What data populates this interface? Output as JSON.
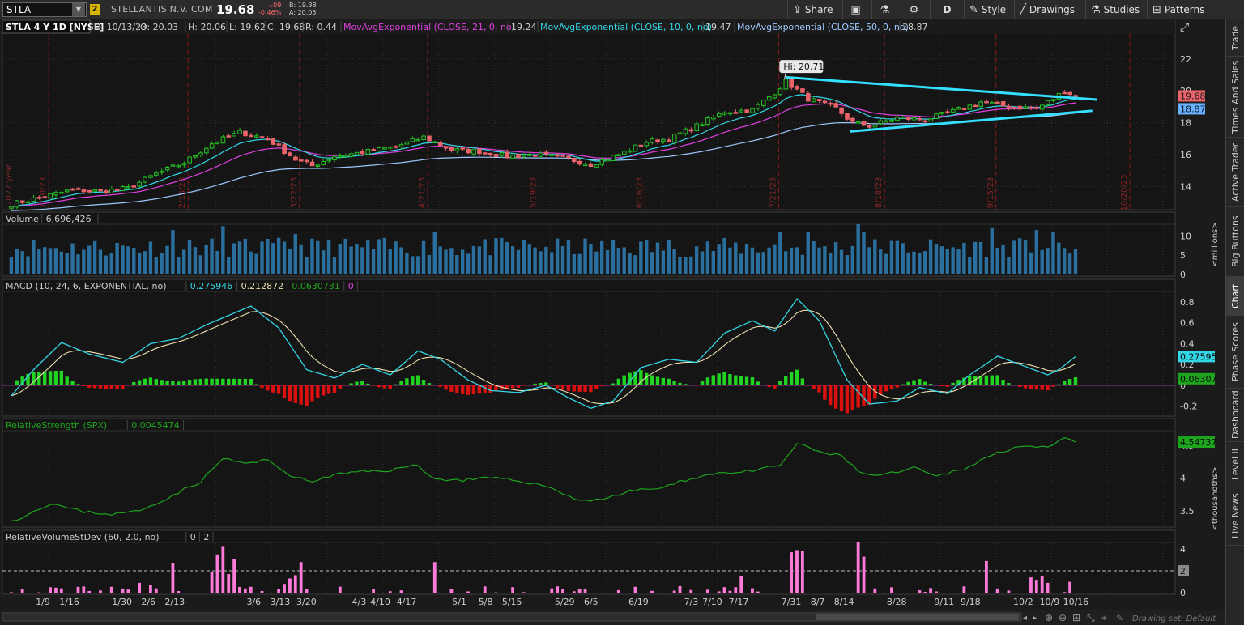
{
  "toolbar": {
    "symbol": "STLA",
    "link_group": "2",
    "company": "STELLANTIS N.V. COM",
    "last": "19.68",
    "change": "-.09",
    "change_pct": "-0.46%",
    "bid": "B: 19.38",
    "ask": "A: 20.05",
    "share": "Share",
    "aggregation": "D",
    "style": "Style",
    "drawings": "Drawings",
    "studies": "Studies",
    "patterns": "Patterns"
  },
  "side_tabs": [
    "Trade",
    "Times And Sales",
    "Active Trader",
    "Big Buttons",
    "Chart",
    "Phase Scores",
    "Dashboard",
    "Level II",
    "Live News"
  ],
  "colors": {
    "up": "#22c322",
    "down": "#e8646a",
    "ema21": "#e040e0",
    "ema10": "#33d6e6",
    "ema50": "#9ec8ff",
    "trend": "#33e0ff",
    "volume": "#2a6f9e",
    "macd_pos": "#22d422",
    "macd_neg": "#dd1010",
    "rs": "#1ea51e",
    "relvol": "#ff7ad9"
  },
  "chart_data": [
    {
      "type": "candlestick",
      "panel": "price",
      "title": "STLA 4 Y 1D [NYSE]",
      "ohlc_header": {
        "d": "D: 10/13/23",
        "o": "O: 20.03",
        "h": "H: 20.06",
        "l": "L: 19.62",
        "c": "C: 19.68",
        "r": "R: 0.44"
      },
      "studies": [
        {
          "name": "MovAvgExponential (CLOSE, 21, 0, no)",
          "value": "19.24",
          "color": "#e040e0"
        },
        {
          "name": "MovAvgExponential (CLOSE, 10, 0, no)",
          "value": "19.47",
          "color": "#33d6e6"
        },
        {
          "name": "MovAvgExponential (CLOSE, 50, 0, no)",
          "value": "18.87",
          "color": "#9ec8ff"
        }
      ],
      "yticks": [
        "22",
        "20",
        "18",
        "16",
        "14"
      ],
      "ylim": [
        12.6,
        22.8
      ],
      "price_labels": [
        {
          "text": "19.68",
          "value": 19.68
        },
        {
          "text": "18.87",
          "value": 18.87
        }
      ],
      "hi_label": "Hi: 20.71",
      "hi_value": 20.71,
      "hi_index": 139,
      "period_markers": [
        "2022 year",
        "1/10/23",
        "2/15/23",
        "3/22/23",
        "4/21/23",
        "5/19/23",
        "6/16/23",
        "7/21/23",
        "8/18/23",
        "9/15/23",
        "10/20/23"
      ],
      "marker_dates": [
        "1/10/23",
        "2/15/23",
        "3/22/23",
        "4/21/23",
        "5/19/23",
        "6/16/23",
        "7/21/23",
        "8/18/23",
        "9/15/23",
        "10/20/23"
      ],
      "anchors": [
        {
          "i": 0,
          "c": 12.9
        },
        {
          "i": 5,
          "c": 13.3
        },
        {
          "i": 11,
          "c": 13.8
        },
        {
          "i": 16,
          "c": 13.7
        },
        {
          "i": 21,
          "c": 13.9
        },
        {
          "i": 26,
          "c": 14.8
        },
        {
          "i": 31,
          "c": 15.5
        },
        {
          "i": 36,
          "c": 16.7
        },
        {
          "i": 41,
          "c": 17.4
        },
        {
          "i": 46,
          "c": 17.0
        },
        {
          "i": 51,
          "c": 15.7
        },
        {
          "i": 54,
          "c": 15.3
        },
        {
          "i": 58,
          "c": 15.9
        },
        {
          "i": 64,
          "c": 16.2
        },
        {
          "i": 69,
          "c": 16.5
        },
        {
          "i": 74,
          "c": 17.1
        },
        {
          "i": 79,
          "c": 16.3
        },
        {
          "i": 84,
          "c": 16.2
        },
        {
          "i": 89,
          "c": 15.9
        },
        {
          "i": 94,
          "c": 16.0
        },
        {
          "i": 99,
          "c": 15.8
        },
        {
          "i": 104,
          "c": 15.4
        },
        {
          "i": 109,
          "c": 16.0
        },
        {
          "i": 114,
          "c": 16.8
        },
        {
          "i": 118,
          "c": 17.0
        },
        {
          "i": 123,
          "c": 17.8
        },
        {
          "i": 128,
          "c": 18.7
        },
        {
          "i": 133,
          "c": 18.8
        },
        {
          "i": 137,
          "c": 19.9
        },
        {
          "i": 139,
          "c": 20.6
        },
        {
          "i": 143,
          "c": 19.5
        },
        {
          "i": 148,
          "c": 18.9
        },
        {
          "i": 151,
          "c": 18.0
        },
        {
          "i": 154,
          "c": 17.8
        },
        {
          "i": 159,
          "c": 18.3
        },
        {
          "i": 164,
          "c": 18.2
        },
        {
          "i": 169,
          "c": 18.7
        },
        {
          "i": 174,
          "c": 19.3
        },
        {
          "i": 179,
          "c": 19.0
        },
        {
          "i": 184,
          "c": 18.9
        },
        {
          "i": 187,
          "c": 19.5
        },
        {
          "i": 189,
          "c": 20.0
        },
        {
          "i": 191,
          "c": 19.68
        }
      ],
      "trendlines": [
        {
          "from": [
            139,
            20.85
          ],
          "to": [
            194.8,
            19.45
          ]
        },
        {
          "from": [
            150.5,
            17.45
          ],
          "to": [
            194,
            18.75
          ]
        }
      ]
    },
    {
      "type": "bar",
      "panel": "volume",
      "title": "Volume",
      "value": "6,696,426",
      "yticks": [
        "10",
        "5",
        "0"
      ],
      "ylim": [
        0,
        13
      ],
      "unit_label": "<millions>"
    },
    {
      "type": "line",
      "panel": "macd",
      "title": "MACD (10, 24, 6, EXPONENTIAL, no)",
      "values_shown": [
        "0.275946",
        "0.212872",
        "0.0630731",
        "0"
      ],
      "yticks": [
        "0.8",
        "0.6",
        "0.4",
        "0.2",
        "0",
        "-0.2"
      ],
      "ylim": [
        -0.28,
        0.9
      ],
      "tags": [
        {
          "text": "0.27595",
          "value": 0.276
        },
        {
          "text": "0.06307",
          "value": 0.063
        }
      ],
      "anchors": [
        {
          "i": 0,
          "v": -0.1
        },
        {
          "i": 4,
          "v": 0.15
        },
        {
          "i": 9,
          "v": 0.41
        },
        {
          "i": 14,
          "v": 0.3
        },
        {
          "i": 20,
          "v": 0.22
        },
        {
          "i": 25,
          "v": 0.4
        },
        {
          "i": 30,
          "v": 0.45
        },
        {
          "i": 35,
          "v": 0.58
        },
        {
          "i": 43,
          "v": 0.76
        },
        {
          "i": 48,
          "v": 0.55
        },
        {
          "i": 53,
          "v": 0.15
        },
        {
          "i": 58,
          "v": 0.07
        },
        {
          "i": 63,
          "v": 0.2
        },
        {
          "i": 68,
          "v": 0.1
        },
        {
          "i": 73,
          "v": 0.33
        },
        {
          "i": 77,
          "v": 0.25
        },
        {
          "i": 82,
          "v": 0.05
        },
        {
          "i": 86,
          "v": -0.05
        },
        {
          "i": 91,
          "v": -0.07
        },
        {
          "i": 96,
          "v": 0.0
        },
        {
          "i": 100,
          "v": -0.12
        },
        {
          "i": 104,
          "v": -0.22
        },
        {
          "i": 108,
          "v": -0.15
        },
        {
          "i": 113,
          "v": 0.17
        },
        {
          "i": 118,
          "v": 0.25
        },
        {
          "i": 123,
          "v": 0.22
        },
        {
          "i": 128,
          "v": 0.5
        },
        {
          "i": 133,
          "v": 0.62
        },
        {
          "i": 137,
          "v": 0.52
        },
        {
          "i": 141,
          "v": 0.83
        },
        {
          "i": 145,
          "v": 0.62
        },
        {
          "i": 150,
          "v": 0.05
        },
        {
          "i": 154,
          "v": -0.18
        },
        {
          "i": 159,
          "v": -0.15
        },
        {
          "i": 163,
          "v": -0.02
        },
        {
          "i": 168,
          "v": -0.08
        },
        {
          "i": 172,
          "v": 0.1
        },
        {
          "i": 177,
          "v": 0.28
        },
        {
          "i": 181,
          "v": 0.2
        },
        {
          "i": 186,
          "v": 0.1
        },
        {
          "i": 188,
          "v": 0.15
        },
        {
          "i": 191,
          "v": 0.276
        }
      ]
    },
    {
      "type": "line",
      "panel": "relative_strength",
      "title": "RelativeStrength (SPX)",
      "value": "0.0045474",
      "yticks": [
        "4.5",
        "4",
        "3.5"
      ],
      "ylim": [
        3.28,
        4.72
      ],
      "tag": {
        "text": "4.54737",
        "value": 4.547
      },
      "unit_label": "<thousandths>",
      "anchors": [
        {
          "i": 0,
          "v": 3.35
        },
        {
          "i": 3,
          "v": 3.45
        },
        {
          "i": 7,
          "v": 3.62
        },
        {
          "i": 12,
          "v": 3.5
        },
        {
          "i": 18,
          "v": 3.45
        },
        {
          "i": 23,
          "v": 3.5
        },
        {
          "i": 28,
          "v": 3.7
        },
        {
          "i": 34,
          "v": 3.95
        },
        {
          "i": 38,
          "v": 4.3
        },
        {
          "i": 42,
          "v": 4.22
        },
        {
          "i": 46,
          "v": 4.27
        },
        {
          "i": 51,
          "v": 4.0
        },
        {
          "i": 54,
          "v": 3.95
        },
        {
          "i": 58,
          "v": 4.05
        },
        {
          "i": 63,
          "v": 4.1
        },
        {
          "i": 68,
          "v": 4.12
        },
        {
          "i": 73,
          "v": 4.2
        },
        {
          "i": 76,
          "v": 3.98
        },
        {
          "i": 81,
          "v": 3.97
        },
        {
          "i": 86,
          "v": 4.0
        },
        {
          "i": 92,
          "v": 3.95
        },
        {
          "i": 97,
          "v": 3.85
        },
        {
          "i": 102,
          "v": 3.65
        },
        {
          "i": 107,
          "v": 3.7
        },
        {
          "i": 112,
          "v": 3.82
        },
        {
          "i": 117,
          "v": 3.85
        },
        {
          "i": 122,
          "v": 4.0
        },
        {
          "i": 127,
          "v": 4.08
        },
        {
          "i": 133,
          "v": 4.1
        },
        {
          "i": 138,
          "v": 4.2
        },
        {
          "i": 141,
          "v": 4.52
        },
        {
          "i": 145,
          "v": 4.4
        },
        {
          "i": 149,
          "v": 4.33
        },
        {
          "i": 153,
          "v": 4.05
        },
        {
          "i": 157,
          "v": 4.05
        },
        {
          "i": 162,
          "v": 4.15
        },
        {
          "i": 166,
          "v": 4.02
        },
        {
          "i": 171,
          "v": 4.15
        },
        {
          "i": 176,
          "v": 4.35
        },
        {
          "i": 181,
          "v": 4.5
        },
        {
          "i": 186,
          "v": 4.45
        },
        {
          "i": 189,
          "v": 4.6
        },
        {
          "i": 191,
          "v": 4.547
        }
      ]
    },
    {
      "type": "bar",
      "panel": "relative_volume",
      "title": "RelativeVolumeStDev (60, 2.0, no)",
      "values_shown": [
        "0",
        "2"
      ],
      "yticks": [
        "4",
        "2",
        "0"
      ],
      "ylim": [
        0,
        4.6
      ],
      "tag": {
        "text": "2",
        "value": 2
      },
      "threshold": 2
    }
  ],
  "x_axis": {
    "labels": [
      {
        "text": "1/9",
        "i": 6
      },
      {
        "text": "1/16",
        "i": 11
      },
      {
        "text": "1/30",
        "i": 21
      },
      {
        "text": "2/6",
        "i": 26
      },
      {
        "text": "2/13",
        "i": 31
      },
      {
        "text": "3/6",
        "i": 46
      },
      {
        "text": "3/13",
        "i": 51
      },
      {
        "text": "3/20",
        "i": 56
      },
      {
        "text": "4/3",
        "i": 66
      },
      {
        "text": "4/10",
        "i": 70
      },
      {
        "text": "4/17",
        "i": 75
      },
      {
        "text": "5/1",
        "i": 85
      },
      {
        "text": "5/8",
        "i": 90
      },
      {
        "text": "5/15",
        "i": 95
      },
      {
        "text": "5/29",
        "i": 105
      },
      {
        "text": "6/5",
        "i": 110
      },
      {
        "text": "6/19",
        "i": 119
      },
      {
        "text": "7/3",
        "i": 129
      },
      {
        "text": "7/10",
        "i": 133
      },
      {
        "text": "7/17",
        "i": 138
      },
      {
        "text": "7/31",
        "i": 148
      },
      {
        "text": "8/7",
        "i": 153
      },
      {
        "text": "8/14",
        "i": 158
      },
      {
        "text": "8/28",
        "i": 168
      },
      {
        "text": "9/11",
        "i": 177
      },
      {
        "text": "9/18",
        "i": 182
      },
      {
        "text": "10/2",
        "i": 192
      },
      {
        "text": "10/9",
        "i": 197
      },
      {
        "text": "10/16",
        "i": 202
      }
    ]
  },
  "status": {
    "drawing_set": "Drawing set: Default"
  }
}
